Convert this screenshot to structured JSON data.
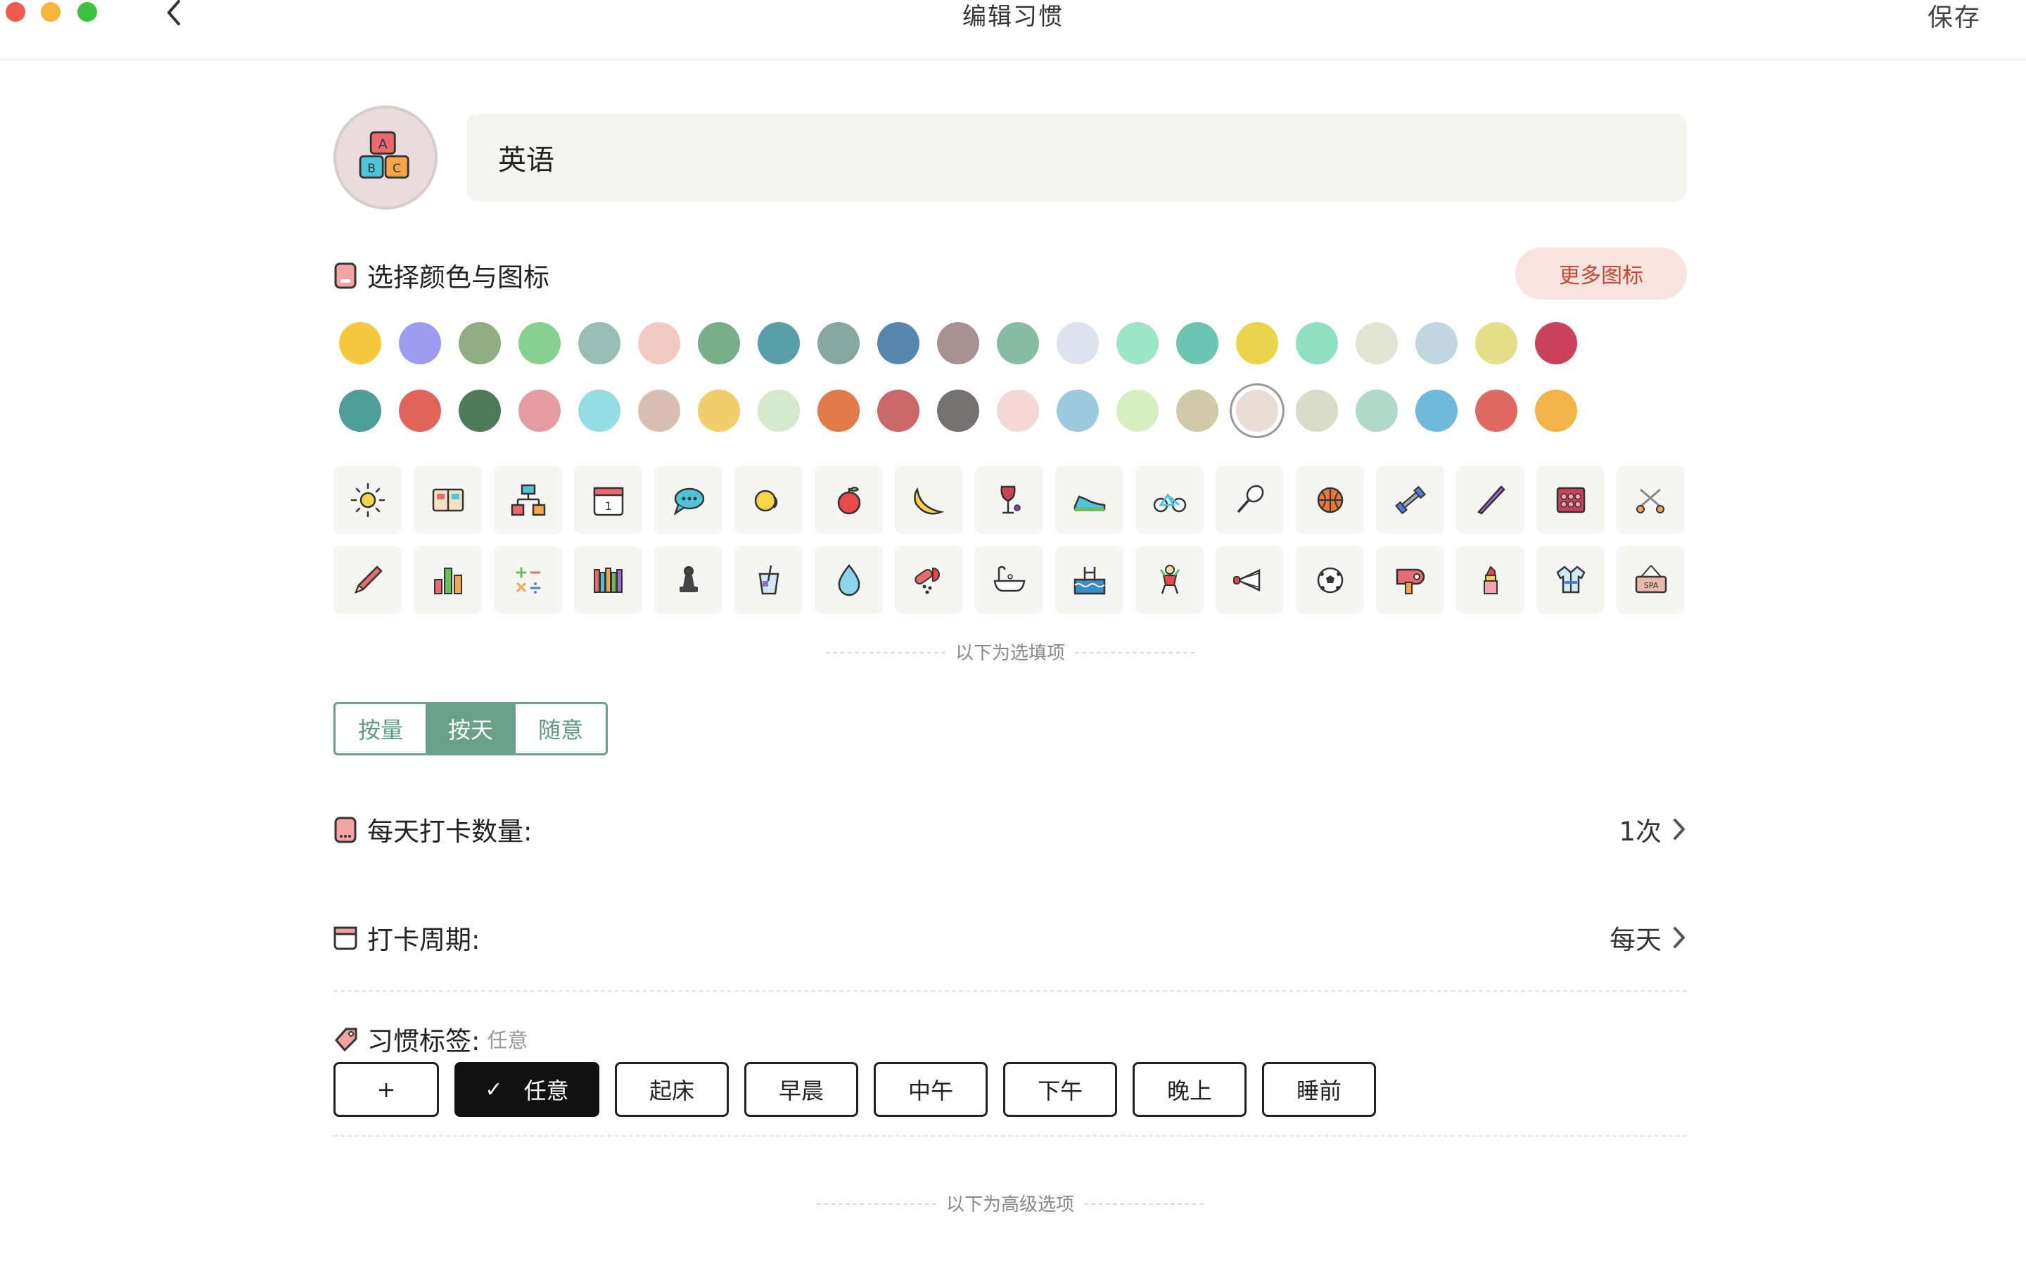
{
  "window": {
    "title": "编辑习惯",
    "save_label": "保存",
    "traffic_lights": [
      "#ee5a52",
      "#f4b63b",
      "#3cc03d"
    ]
  },
  "habit": {
    "name": "英语",
    "avatar_icon": "abc-blocks-icon"
  },
  "color_section": {
    "title": "选择颜色与图标",
    "more_label": "更多图标",
    "row1": [
      "#f5c842",
      "#9d9cf0",
      "#8fae84",
      "#86d18f",
      "#97bcb6",
      "#f0cbc5",
      "#7aad8a",
      "#5a9ea8",
      "#86a6a2",
      "#5a86ad",
      "#a79193",
      "#8abca4",
      "#dde3ec",
      "#9ee4c8",
      "#6cc5b0",
      "#e8d54c",
      "#8fe0c3",
      "#e1e4d3",
      "#c2d6e0",
      "#e3df8a",
      "#c8425c"
    ],
    "row2": [
      "#4f9f96",
      "#e0635c",
      "#4d7a5a",
      "#e59ba2",
      "#95dde3",
      "#d6bfb2",
      "#f2cd6b",
      "#d6e8cb",
      "#e17a4a",
      "#c86868",
      "#767171",
      "#f3d8d8",
      "#9dc9df",
      "#d8eec0",
      "#cfcba8",
      "#e8dcd6",
      "#d9dcc7",
      "#b1d9ca",
      "#6fb9dc",
      "#df6a63",
      "#f1b44a"
    ],
    "selected_row": 2,
    "selected_index": 15
  },
  "icons": {
    "row1": [
      "sun-icon",
      "book-icon",
      "hierarchy-icon",
      "calendar-icon",
      "chat-icon",
      "lemon-icon",
      "apple-icon",
      "banana-icon",
      "wine-icon",
      "sneaker-icon",
      "bicycle-icon",
      "racket-icon",
      "basketball-icon",
      "dumbbell-icon",
      "hair-straightener-icon",
      "palette-icon",
      "scissors-icon"
    ],
    "row2": [
      "pencil-icon",
      "chart-icon",
      "math-icon",
      "bookshelf-icon",
      "chess-pawn-icon",
      "drink-icon",
      "water-drop-icon",
      "pills-icon",
      "bathtub-icon",
      "swimming-pool-icon",
      "cheerleader-icon",
      "shuttlecock-icon",
      "soccer-icon",
      "hair-dryer-icon",
      "lipstick-icon",
      "robe-icon",
      "spa-sign-icon"
    ],
    "calendar_day": "1",
    "spa_label": "SPA"
  },
  "optional_label": "以下为选填项",
  "mode_tabs": [
    {
      "label": "按量",
      "active": false
    },
    {
      "label": "按天",
      "active": true
    },
    {
      "label": "随意",
      "active": false
    }
  ],
  "daily_count": {
    "label": "每天打卡数量:",
    "value": "1次"
  },
  "period": {
    "label": "打卡周期:",
    "value": "每天"
  },
  "tags_section": {
    "label": "习惯标签:",
    "current": "任意",
    "add_label": "+",
    "items": [
      {
        "label": "任意",
        "active": true
      },
      {
        "label": "起床",
        "active": false
      },
      {
        "label": "早晨",
        "active": false
      },
      {
        "label": "中午",
        "active": false
      },
      {
        "label": "下午",
        "active": false
      },
      {
        "label": "晚上",
        "active": false
      },
      {
        "label": "睡前",
        "active": false
      }
    ]
  },
  "advanced_label": "以下为高级选项"
}
